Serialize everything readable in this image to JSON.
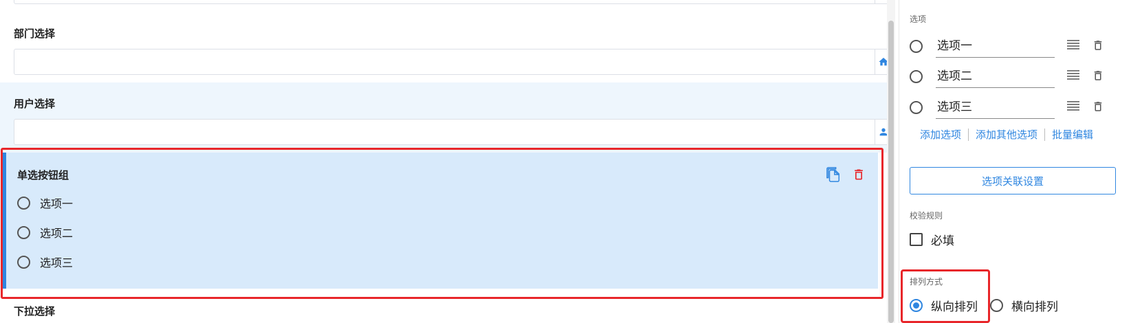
{
  "canvas": {
    "dept_field": {
      "label": "部门选择",
      "value": ""
    },
    "user_field": {
      "label": "用户选择",
      "value": ""
    },
    "radio_group": {
      "title": "单选按钮组",
      "options": [
        "选项一",
        "选项二",
        "选项三"
      ]
    },
    "dropdown_field": {
      "label": "下拉选择"
    }
  },
  "panel": {
    "options_label": "选项",
    "options": [
      {
        "value": "选项一"
      },
      {
        "value": "选项二"
      },
      {
        "value": "选项三"
      }
    ],
    "links": {
      "add_option": "添加选项",
      "add_other": "添加其他选项",
      "batch_edit": "批量编辑"
    },
    "linkage_button": "选项关联设置",
    "validation_label": "校验规则",
    "required_label": "必填",
    "layout_label": "排列方式",
    "layout_vertical": "纵向排列",
    "layout_horizontal": "横向排列"
  },
  "colors": {
    "accent": "#2f86e0",
    "selected_bg": "#d8eafb",
    "hover_bg": "#eef6fd",
    "highlight": "#e8262a",
    "delete": "#e8262a"
  },
  "icons": {
    "dept_addon": "home-icon",
    "user_addon": "person-icon",
    "copy": "copy-icon",
    "delete": "trash-icon",
    "drag": "drag-handle-icon"
  }
}
